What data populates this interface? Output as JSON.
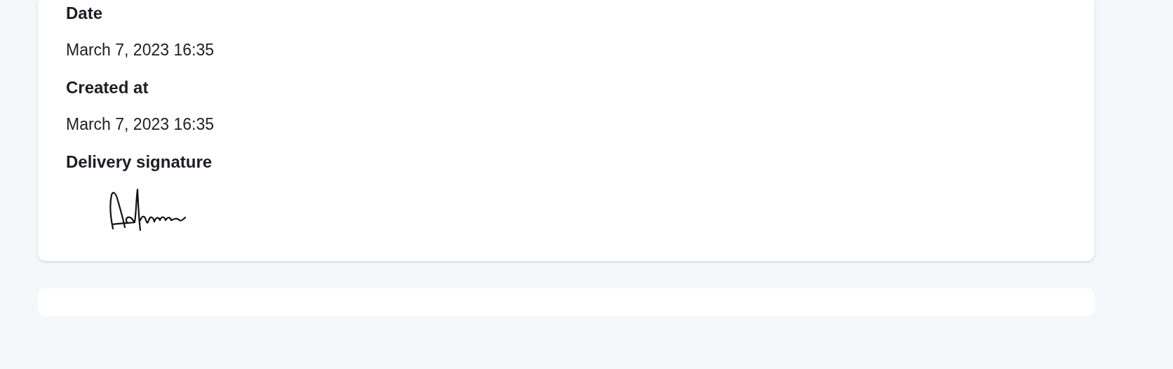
{
  "fields": [
    {
      "label": "Date",
      "value": "March 7, 2023 16:35"
    },
    {
      "label": "Created at",
      "value": "March 7, 2023 16:35"
    }
  ],
  "signature": {
    "label": "Delivery signature"
  }
}
